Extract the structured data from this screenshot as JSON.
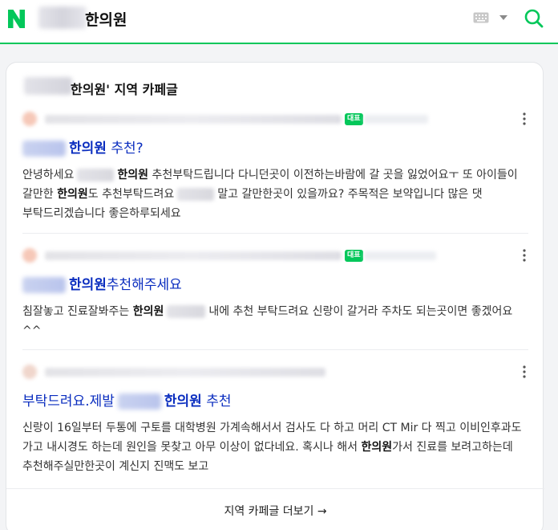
{
  "header": {
    "logo": "N",
    "query_suffix": "한의원",
    "icons": {
      "keyboard": "keyboard-icon",
      "caret": "caret-down-icon",
      "search": "search-icon"
    },
    "accent": "#03c75a"
  },
  "card": {
    "title": "한의원' 지역 카페글",
    "more_label": "지역 카페글 더보기 →",
    "posts": [
      {
        "badge": "대표",
        "title_keyword": "한의원",
        "title_rest": " 추천?",
        "desc": {
          "p1": "안녕하세요",
          "kw1": "한의원",
          "p2": " 추천부탁드립니다 다니던곳이 이전하는바람에 갈 곳을 잃었어요ㅜ 또 아이들이 갈만한 ",
          "kw2": "한의원",
          "p3": "도 추천부탁드려요",
          "p4": "말고 갈만한곳이 있을까요? 주목적은 보약입니다 많은 댓 부탁드리겠습니다 좋은하루되세요"
        }
      },
      {
        "badge": "대표",
        "title_keyword": "한의원",
        "title_rest": "추천해주세요",
        "desc": {
          "p1": "침잘놓고 진료잘봐주는 ",
          "kw1": "한의원",
          "p2": "내에 추천 부탁드려요 신랑이 갈거라 주차도 되는곳이면 좋겠어요 ^^"
        }
      },
      {
        "title_prefix": "부탁드려요.제발",
        "title_keyword": "한의원",
        "title_rest": " 추천",
        "desc": {
          "p1": "신랑이 16일부터 두통에 구토를 대학병원 가계속해서서 검사도 다 하고 머리 CT Mir 다 찍고 이비인후과도 가고 내시경도 하는데 원인을 못찾고 아무 이상이 없다네요. 혹시나 해서 ",
          "kw1": "한의원",
          "p2": "가서 진료를 보려고하는데 추천해주실만한곳이 계신지 진맥도 보고"
        }
      }
    ]
  }
}
